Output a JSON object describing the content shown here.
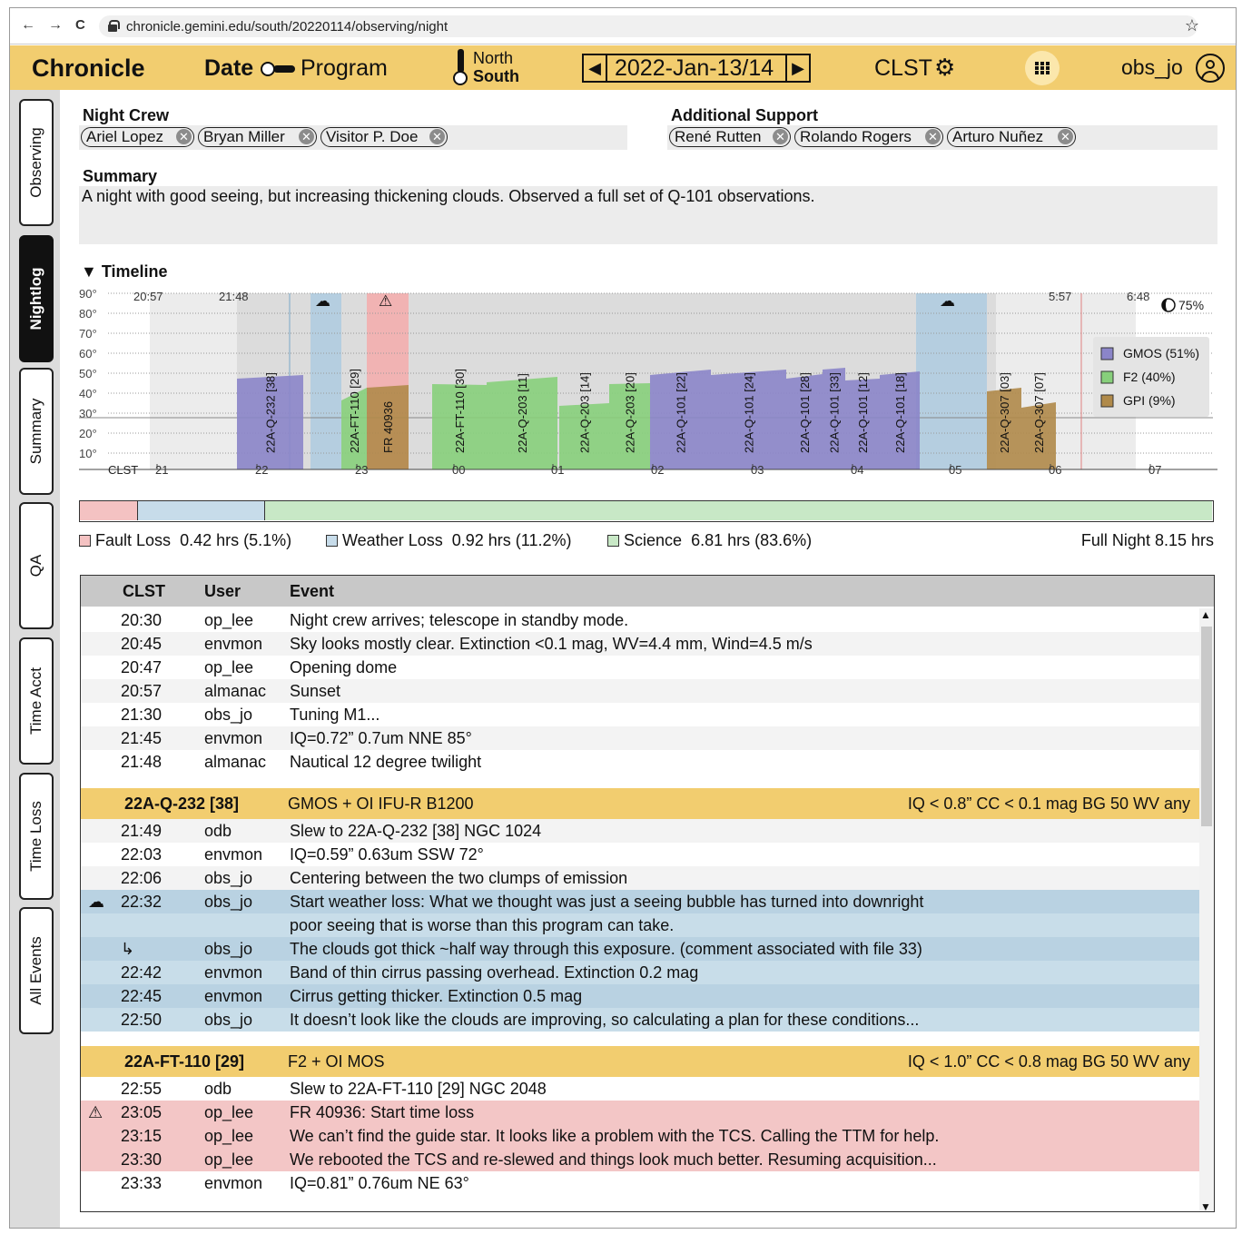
{
  "browser": {
    "url": "chronicle.gemini.edu/south/20220114/observing/night",
    "back": "←",
    "forward": "→",
    "reload": "C",
    "star": "☆"
  },
  "header": {
    "brand": "Chronicle",
    "date_label": "Date",
    "program_label": "Program",
    "site_north": "North",
    "site_south": "South",
    "date": "2022-Jan-13/14",
    "prev": "◀",
    "next": "▶",
    "timezone": "CLST",
    "gear": "⚙",
    "user": "obs_jo"
  },
  "sidebar": [
    "Observing",
    "Nightlog",
    "Summary",
    "QA",
    "Time Acct",
    "Time Loss",
    "All Events"
  ],
  "night_crew": {
    "label": "Night Crew",
    "people": [
      "Ariel Lopez",
      "Bryan Miller",
      "Visitor P. Doe"
    ]
  },
  "additional_support": {
    "label": "Additional Support",
    "people": [
      "René Rutten",
      "Rolando Rogers",
      "Arturo Nuñez"
    ]
  },
  "summary": {
    "label": "Summary",
    "text": "A night with good seeing, but increasing thickening clouds. Observed a full set of Q-101 observations."
  },
  "timeline": {
    "title": "▼ Timeline",
    "clst_label": "CLST",
    "alt_labels": [
      "90°",
      "80°",
      "70°",
      "60°",
      "50°",
      "40°",
      "30°",
      "20°",
      "10°"
    ],
    "hour_labels": [
      "21",
      "22",
      "23",
      "00",
      "01",
      "02",
      "03",
      "04",
      "05",
      "06",
      "07"
    ],
    "time_marks": [
      "20:57",
      "21:48",
      "5:57",
      "6:48"
    ],
    "moon": "75%",
    "fault_icon": "⚠",
    "weather_icon": "☁",
    "legend": [
      {
        "name": "GMOS (51%)",
        "color": "#8b85c9"
      },
      {
        "name": "F2 (40%)",
        "color": "#87cf7b"
      },
      {
        "name": "GPI (9%)",
        "color": "#b08a4a"
      }
    ],
    "bars": [
      {
        "label": "22A-Q-232 [38]",
        "color": "#8b85c9"
      },
      {
        "label": "22A-FT-110 [29]",
        "color": "#87cf7b"
      },
      {
        "label": "FR 40936",
        "color": "#b08a4a"
      },
      {
        "label": "22A-FT-110 [30]",
        "color": "#87cf7b"
      },
      {
        "label": "22A-Q-203 [11]",
        "color": "#87cf7b"
      },
      {
        "label": "22A-Q-203 [14]",
        "color": "#87cf7b"
      },
      {
        "label": "22A-Q-203 [20]",
        "color": "#87cf7b"
      },
      {
        "label": "22A-Q-101 [22]",
        "color": "#8b85c9"
      },
      {
        "label": "22A-Q-101 [24]",
        "color": "#8b85c9"
      },
      {
        "label": "22A-Q-101 [28]",
        "color": "#8b85c9"
      },
      {
        "label": "22A-Q-101 [33]",
        "color": "#8b85c9"
      },
      {
        "label": "22A-Q-101 [12]",
        "color": "#8b85c9"
      },
      {
        "label": "22A-Q-101 [18]",
        "color": "#8b85c9"
      },
      {
        "label": "22A-Q-307 [03]",
        "color": "#b08a4a"
      },
      {
        "label": "22A-Q-307 [07]",
        "color": "#b08a4a"
      }
    ]
  },
  "loss": {
    "fault_label": "Fault Loss",
    "fault_value": "0.42 hrs (5.1%)",
    "fault_fraction": 0.051,
    "weather_label": "Weather Loss",
    "weather_value": "0.92 hrs (11.2%)",
    "weather_fraction": 0.112,
    "science_label": "Science",
    "science_value": "6.81 hrs (83.6%)",
    "science_fraction": 0.836,
    "full_night": "Full Night 8.15 hrs",
    "colors": {
      "fault": "#f4c2c2",
      "weather": "#c7dcea",
      "science": "#c8e8c6"
    }
  },
  "events": {
    "headers": [
      "CLST",
      "User",
      "Event"
    ],
    "rows": [
      {
        "kind": "e",
        "time": "20:30",
        "user": "op_lee",
        "text": "Night crew arrives; telescope in standby mode."
      },
      {
        "kind": "e",
        "time": "20:45",
        "user": "envmon",
        "text": "Sky looks mostly clear.  Extinction <0.1 mag, WV=4.4 mm, Wind=4.5 m/s"
      },
      {
        "kind": "e",
        "time": "20:47",
        "user": "op_lee",
        "text": "Opening dome"
      },
      {
        "kind": "e",
        "time": "20:57",
        "user": "almanac",
        "text": "Sunset"
      },
      {
        "kind": "e",
        "time": "21:30",
        "user": "obs_jo",
        "text": "Tuning M1..."
      },
      {
        "kind": "e",
        "time": "21:45",
        "user": "envmon",
        "text": "IQ=0.72”  0.7um  NNE  85°"
      },
      {
        "kind": "e",
        "time": "21:48",
        "user": "almanac",
        "text": "Nautical 12 degree twilight"
      },
      {
        "kind": "g"
      },
      {
        "kind": "h",
        "obs": "22A-Q-232 [38]",
        "inst": "GMOS + OI  IFU-R  B1200",
        "cond": "IQ < 0.8”  CC < 0.1 mag  BG 50  WV any"
      },
      {
        "kind": "e",
        "time": "21:49",
        "user": "odb",
        "text": "Slew to 22A-Q-232 [38]   NGC 1024"
      },
      {
        "kind": "e",
        "time": "22:03",
        "user": "envmon",
        "text": "IQ=0.59”  0.63um  SSW  72°"
      },
      {
        "kind": "e",
        "time": "22:06",
        "user": "obs_jo",
        "text": "Centering between the two clumps of emission"
      },
      {
        "kind": "w",
        "icon": "☁",
        "time": "22:32",
        "user": "obs_jo",
        "text": "Start weather loss: What we thought was just a seeing bubble has turned into downright"
      },
      {
        "kind": "w",
        "time": "",
        "user": "",
        "text": "poor seeing that is worse than this program can take."
      },
      {
        "kind": "w",
        "icon": "↳",
        "time": "",
        "user": "obs_jo",
        "text": "The clouds got thick ~half way through this exposure.  (comment associated with file 33)"
      },
      {
        "kind": "w",
        "time": "22:42",
        "user": "envmon",
        "text": "Band of thin cirrus passing overhead.  Extinction 0.2 mag"
      },
      {
        "kind": "w",
        "time": "22:45",
        "user": "envmon",
        "text": "Cirrus getting thicker.  Extinction 0.5 mag"
      },
      {
        "kind": "w",
        "time": "22:50",
        "user": "obs_jo",
        "text": "It doesn’t look like the clouds are improving, so calculating a plan for these conditions..."
      },
      {
        "kind": "g"
      },
      {
        "kind": "h",
        "obs": "22A-FT-110 [29]",
        "inst": "F2 + OI  MOS",
        "cond": "IQ < 1.0”  CC < 0.8 mag  BG 50  WV any"
      },
      {
        "kind": "e",
        "time": "22:55",
        "user": "odb",
        "text": "Slew to 22A-FT-110 [29]   NGC 2048"
      },
      {
        "kind": "f",
        "icon": "⚠",
        "time": "23:05",
        "user": "op_lee",
        "text": "FR 40936: Start time loss"
      },
      {
        "kind": "f",
        "time": "23:15",
        "user": "op_lee",
        "text": "We can’t find the guide star. It looks like a problem with the TCS.   Calling the TTM for help."
      },
      {
        "kind": "f",
        "time": "23:30",
        "user": "op_lee",
        "text": "We rebooted the TCS and re-slewed and things look much better.  Resuming acquisition..."
      },
      {
        "kind": "e",
        "time": "23:33",
        "user": "envmon",
        "text": "IQ=0.81”  0.76um   NE   63°"
      }
    ]
  }
}
